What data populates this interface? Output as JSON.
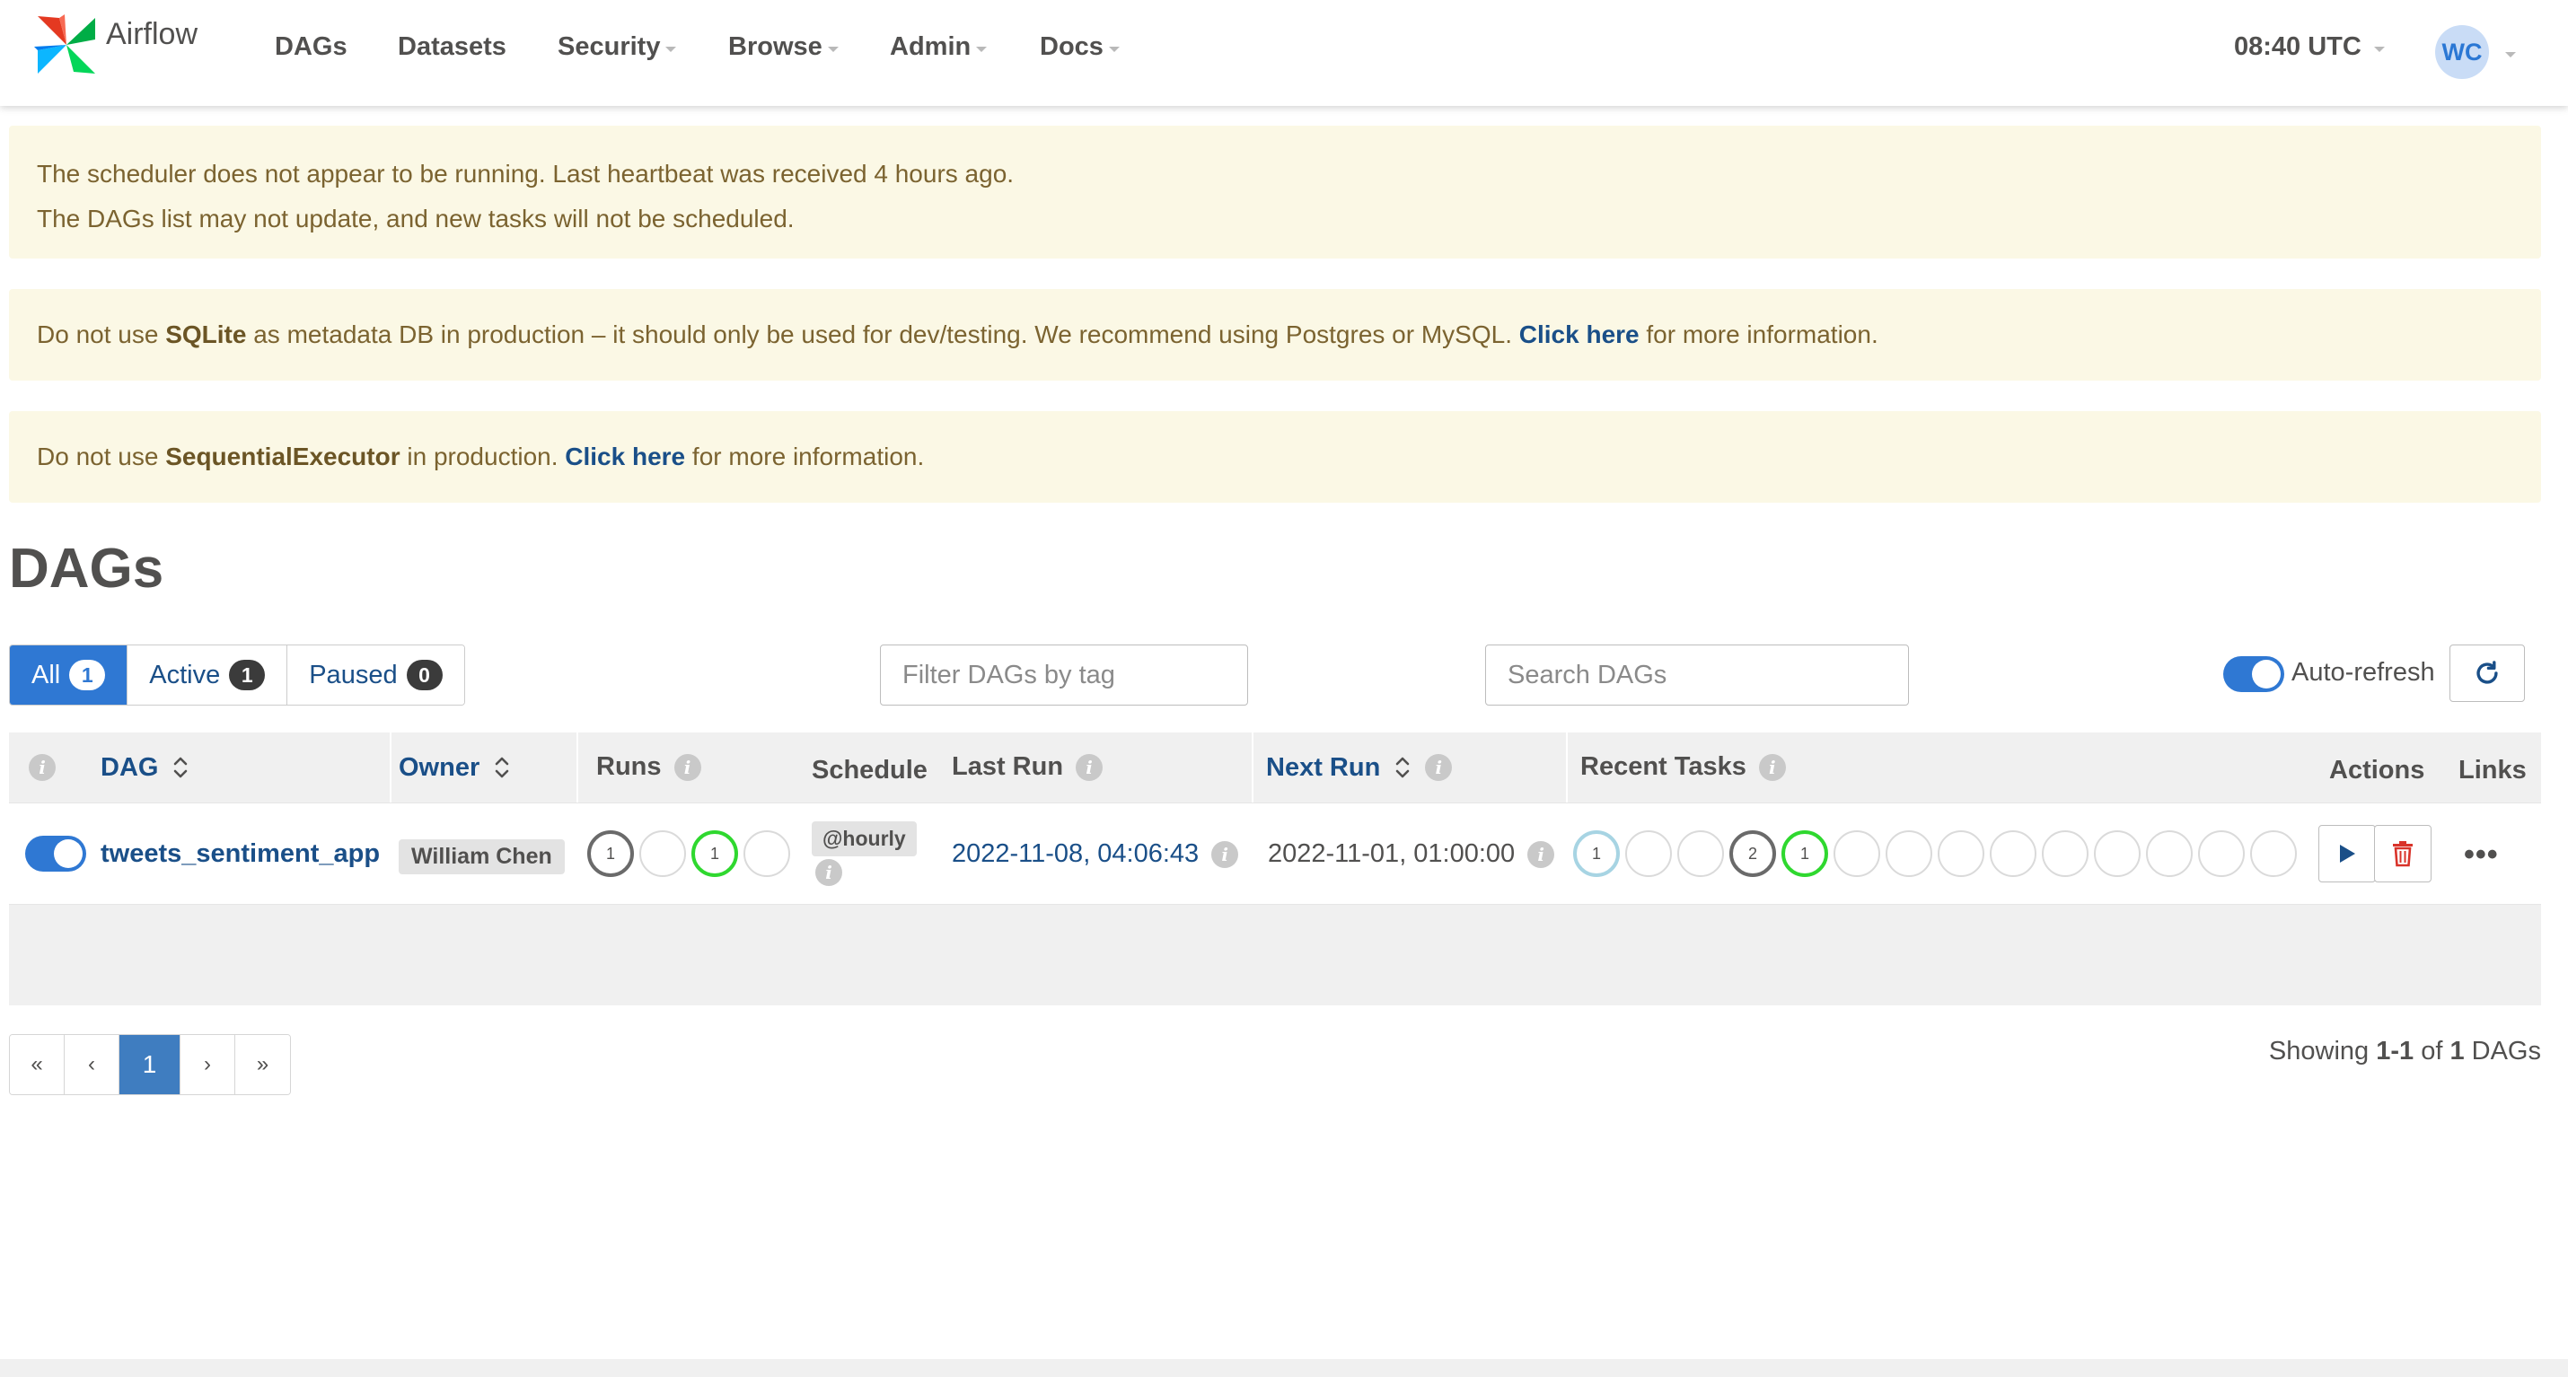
{
  "navbar": {
    "brand": "Airflow",
    "items": [
      {
        "label": "DAGs",
        "dropdown": false
      },
      {
        "label": "Datasets",
        "dropdown": false
      },
      {
        "label": "Security",
        "dropdown": true
      },
      {
        "label": "Browse",
        "dropdown": true
      },
      {
        "label": "Admin",
        "dropdown": true
      },
      {
        "label": "Docs",
        "dropdown": true
      }
    ],
    "clock": "08:40 UTC",
    "user_initials": "WC"
  },
  "alerts": {
    "scheduler_line1": "The scheduler does not appear to be running. Last heartbeat was received 4 hours ago.",
    "scheduler_line2": "The DAGs list may not update, and new tasks will not be scheduled.",
    "sqlite_pre": "Do not use ",
    "sqlite_bold": "SQLite",
    "sqlite_mid": " as metadata DB in production – it should only be used for dev/testing. We recommend using Postgres or MySQL. ",
    "sqlite_link": "Click here",
    "sqlite_post": " for more information.",
    "executor_pre": "Do not use ",
    "executor_bold": "SequentialExecutor",
    "executor_mid": " in production. ",
    "executor_link": "Click here",
    "executor_post": " for more information."
  },
  "page_title": "DAGs",
  "filters": {
    "status": [
      {
        "label": "All",
        "count": "1"
      },
      {
        "label": "Active",
        "count": "1"
      },
      {
        "label": "Paused",
        "count": "0"
      }
    ],
    "tag_placeholder": "Filter DAGs by tag",
    "search_placeholder": "Search DAGs",
    "auto_refresh_label": "Auto-refresh"
  },
  "table": {
    "columns": {
      "dag": "DAG",
      "owner": "Owner",
      "runs": "Runs",
      "schedule": "Schedule",
      "last_run": "Last Run",
      "next_run": "Next Run",
      "recent_tasks": "Recent Tasks",
      "actions": "Actions",
      "links": "Links"
    },
    "rows": [
      {
        "dag_id": "tweets_sentiment_app",
        "owner": "William Chen",
        "runs": [
          "1",
          "",
          "1",
          ""
        ],
        "schedule": "@hourly",
        "last_run": "2022-11-08, 04:06:43",
        "next_run": "2022-11-01, 01:00:00",
        "recent_tasks": [
          "1",
          "",
          "",
          "2",
          "1",
          "",
          "",
          "",
          "",
          "",
          "",
          "",
          "",
          ""
        ],
        "more": "•••"
      }
    ]
  },
  "pagination": {
    "first": "«",
    "prev": "‹",
    "current": "1",
    "next": "›",
    "last": "»"
  },
  "showing": {
    "prefix": "Showing ",
    "range": "1-1",
    "of": " of ",
    "total": "1",
    "suffix": " DAGs"
  },
  "colors": {
    "primary": "#2f78d3",
    "link": "#1a4f88",
    "alert_bg": "#fbf8e5",
    "success": "#2fd82f",
    "queued": "#6a6a6a",
    "running_light": "#a7d4e3"
  }
}
